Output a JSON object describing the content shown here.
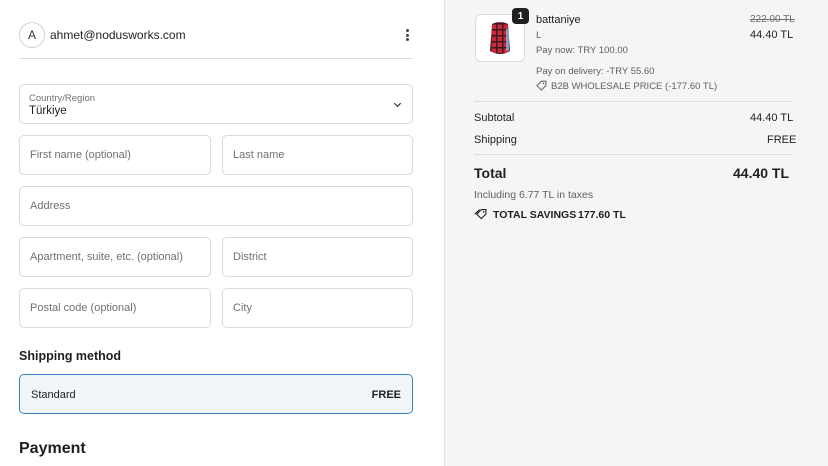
{
  "account": {
    "avatar_initial": "A",
    "email": "ahmet@nodusworks.com"
  },
  "address_form": {
    "country_label": "Country/Region",
    "country_value": "Türkiye",
    "first_name_placeholder": "First name (optional)",
    "last_name_placeholder": "Last name",
    "address_placeholder": "Address",
    "apartment_placeholder": "Apartment, suite, etc. (optional)",
    "district_placeholder": "District",
    "postal_code_placeholder": "Postal code (optional)",
    "city_placeholder": "City"
  },
  "shipping": {
    "title": "Shipping method",
    "option_name": "Standard",
    "option_price": "FREE"
  },
  "payment": {
    "title": "Payment"
  },
  "order": {
    "item": {
      "quantity": "1",
      "name": "battaniye",
      "variant": "L",
      "original_price": "222.00 TL",
      "price": "44.40 TL",
      "pay_now": "Pay now: TRY 100.00",
      "pay_on_delivery": "Pay on delivery: -TRY 55.60",
      "discount": "B2B WHOLESALE PRICE (-177.60 TL)"
    },
    "subtotal_label": "Subtotal",
    "subtotal_value": "44.40 TL",
    "shipping_label": "Shipping",
    "shipping_value": "FREE",
    "total_label": "Total",
    "total_value": "44.40 TL",
    "taxes_note": "Including 6.77 TL in taxes",
    "savings_label": "TOTAL SAVINGS",
    "savings_value": "177.60 TL"
  },
  "colors": {
    "accent": "#3b7fc4",
    "selected_bg": "#f0f5fa",
    "summary_bg": "#f5f5f5"
  }
}
